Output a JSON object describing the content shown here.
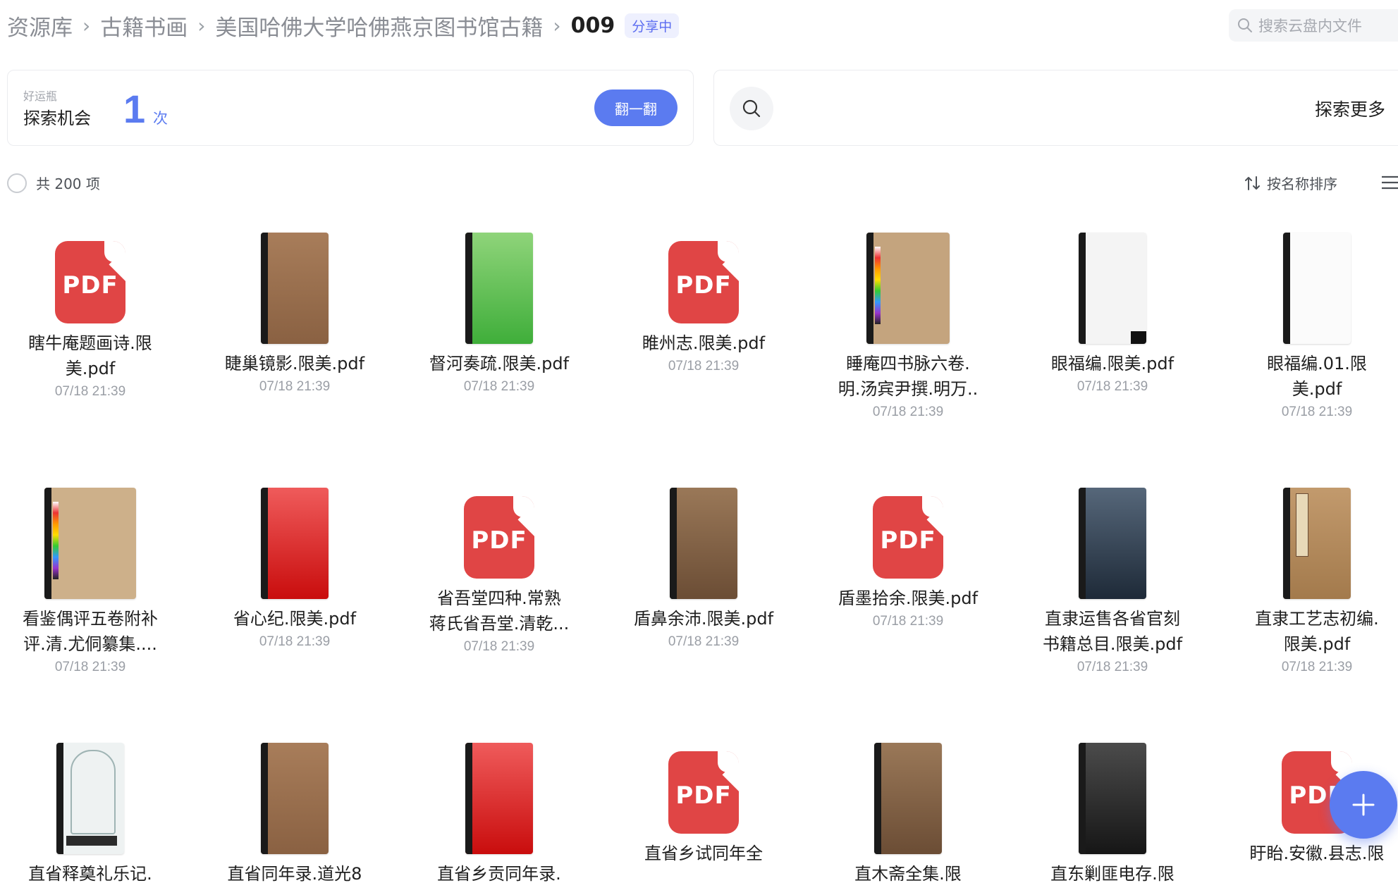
{
  "breadcrumb": {
    "items": [
      "资源库",
      "古籍书画",
      "美国哈佛大学哈佛燕京图书馆古籍"
    ],
    "current": "009",
    "badge": "分享中"
  },
  "search": {
    "placeholder": "搜索云盘内文件"
  },
  "luck_card": {
    "small_label": "好运瓶",
    "main_label": "探索机会",
    "count": "1",
    "unit": "次",
    "button": "翻一翻"
  },
  "explore_card": {
    "label": "探索更多"
  },
  "toolbar": {
    "count_text": "共 200 项",
    "sort_label": "按名称排序"
  },
  "files": [
    {
      "name_l1": "瞎牛庵题画诗.限",
      "name_l2": "美.pdf",
      "date": "07/18 21:39",
      "thumb": "pdf"
    },
    {
      "name_l1": "睫巢镜影.限美.pdf",
      "name_l2": "",
      "date": "07/18 21:39",
      "thumb": "book-brown"
    },
    {
      "name_l1": "督河奏疏.限美.pdf",
      "name_l2": "",
      "date": "07/18 21:39",
      "thumb": "book-green"
    },
    {
      "name_l1": "睢州志.限美.pdf",
      "name_l2": "",
      "date": "07/18 21:39",
      "thumb": "pdf"
    },
    {
      "name_l1": "睡庵四书脉六卷.",
      "name_l2": "明.汤宾尹撰.明万..",
      "date": "07/18 21:39",
      "thumb": "book-tan-chart"
    },
    {
      "name_l1": "眼福编.限美.pdf",
      "name_l2": "",
      "date": "07/18 21:39",
      "thumb": "book-white-dark"
    },
    {
      "name_l1": "眼福编.01.限",
      "name_l2": "美.pdf",
      "date": "07/18 21:39",
      "thumb": "book-white"
    },
    {
      "name_l1": "看鉴偶评五卷附补",
      "name_l2": "评.清.尤侗纂集....",
      "date": "07/18 21:39",
      "thumb": "book-tan-chart-wide"
    },
    {
      "name_l1": "省心纪.限美.pdf",
      "name_l2": "",
      "date": "07/18 21:39",
      "thumb": "book-red"
    },
    {
      "name_l1": "省吾堂四种.常熟",
      "name_l2": "蒋氏省吾堂.清乾...",
      "date": "07/18 21:39",
      "thumb": "pdf"
    },
    {
      "name_l1": "盾鼻余沛.限美.pdf",
      "name_l2": "",
      "date": "07/18 21:39",
      "thumb": "book-brown-dark"
    },
    {
      "name_l1": "盾墨拾余.限美.pdf",
      "name_l2": "",
      "date": "07/18 21:39",
      "thumb": "pdf"
    },
    {
      "name_l1": "直隶运售各省官刻",
      "name_l2": "书籍总目.限美.pdf",
      "date": "07/18 21:39",
      "thumb": "book-navy"
    },
    {
      "name_l1": "直隶工艺志初编.",
      "name_l2": "限美.pdf",
      "date": "07/18 21:39",
      "thumb": "book-label"
    },
    {
      "name_l1": "直省释奠礼乐记.",
      "name_l2": "",
      "date": "",
      "thumb": "book-illustrated"
    },
    {
      "name_l1": "直省同年录.道光8",
      "name_l2": "",
      "date": "",
      "thumb": "book-brown"
    },
    {
      "name_l1": "直省乡贡同年录.",
      "name_l2": "",
      "date": "",
      "thumb": "book-red"
    },
    {
      "name_l1": "直省乡试同年全",
      "name_l2": "",
      "date": "",
      "thumb": "pdf"
    },
    {
      "name_l1": "直木斋全集.限",
      "name_l2": "",
      "date": "",
      "thumb": "book-brown-dark"
    },
    {
      "name_l1": "直东剿匪电存.限",
      "name_l2": "",
      "date": "",
      "thumb": "book-black"
    },
    {
      "name_l1": "盱眙.安徽.县志.限",
      "name_l2": "",
      "date": "",
      "thumb": "pdf"
    }
  ],
  "colors": {
    "accent": "#5b7bf0",
    "pdf_red": "#e04545",
    "text_muted": "#9a9ea5"
  },
  "icons": [
    "search-icon",
    "sort-icon",
    "list-view-icon",
    "plus-icon",
    "chevron-right-icon"
  ]
}
